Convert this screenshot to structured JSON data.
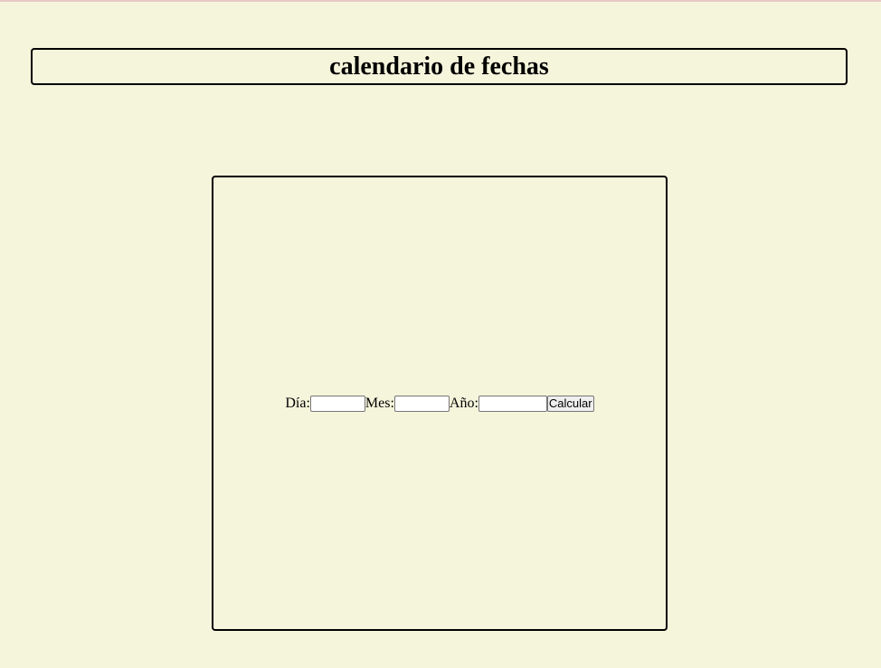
{
  "header": {
    "title": "calendario de fechas"
  },
  "form": {
    "dia_label": "Día:",
    "dia_value": "",
    "mes_label": "Mes:",
    "mes_value": "",
    "ano_label": "Año:",
    "ano_value": "",
    "submit_label": "Calcular"
  },
  "colors": {
    "background": "#f5f5dc",
    "border": "#000000"
  }
}
